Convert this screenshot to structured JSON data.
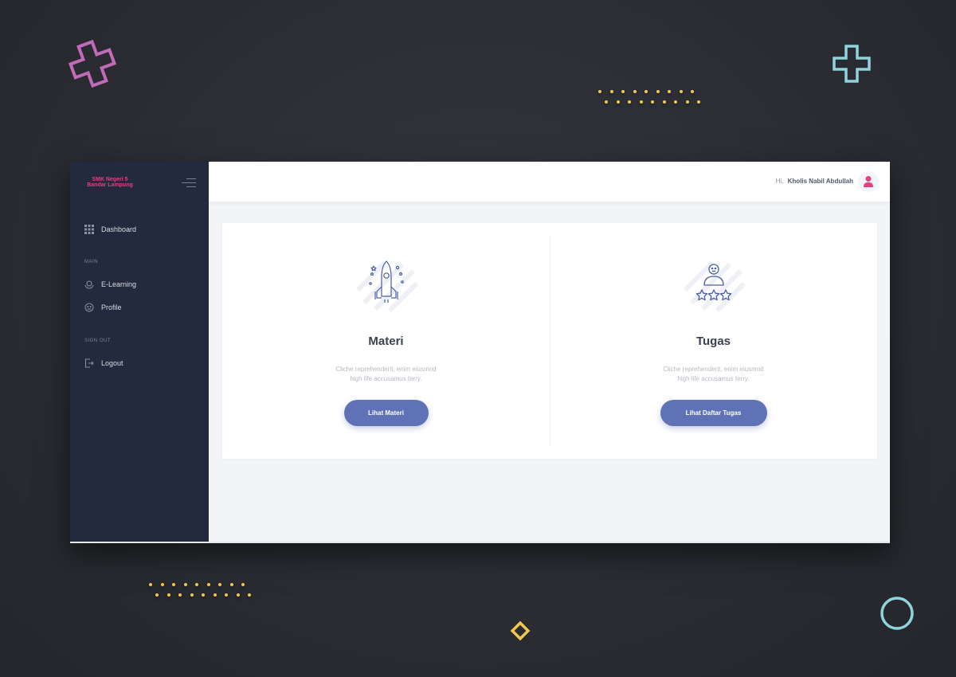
{
  "app": {
    "brand_line1": "SMK Negeri 5",
    "brand_line2": "Bandar Lampung"
  },
  "sidebar": {
    "items": [
      {
        "label": "Dashboard",
        "icon": "grid-icon"
      },
      {
        "label": "E-Learning",
        "icon": "globe-hands-icon"
      },
      {
        "label": "Profile",
        "icon": "smiley-icon"
      },
      {
        "label": "Logout",
        "icon": "logout-icon"
      }
    ],
    "sections": {
      "main": "MAIN",
      "sign_out": "SIGN OUT"
    }
  },
  "header": {
    "greeting": "Hi,",
    "user_name": "Kholis Nabil Abdullah"
  },
  "cards": [
    {
      "title": "Materi",
      "desc_line1": "Cliche reprehenderit, enim eiusmod",
      "desc_line2": "high life accusamus terry.",
      "button": "Lihat Materi",
      "icon": "rocket-icon"
    },
    {
      "title": "Tugas",
      "desc_line1": "Cliche reprehenderit, enim eiusmod",
      "desc_line2": "high life accusamus terry.",
      "button": "Lihat Daftar Tugas",
      "icon": "user-rating-icon"
    }
  ],
  "colors": {
    "accent": "#5f72b6",
    "brand": "#e83e7f",
    "sidebar_bg": "#232a3d",
    "backdrop": "#2a2c32",
    "deco_pink": "#c06ab8",
    "deco_cyan": "#8fd3dc",
    "deco_yellow": "#f2c94c"
  }
}
